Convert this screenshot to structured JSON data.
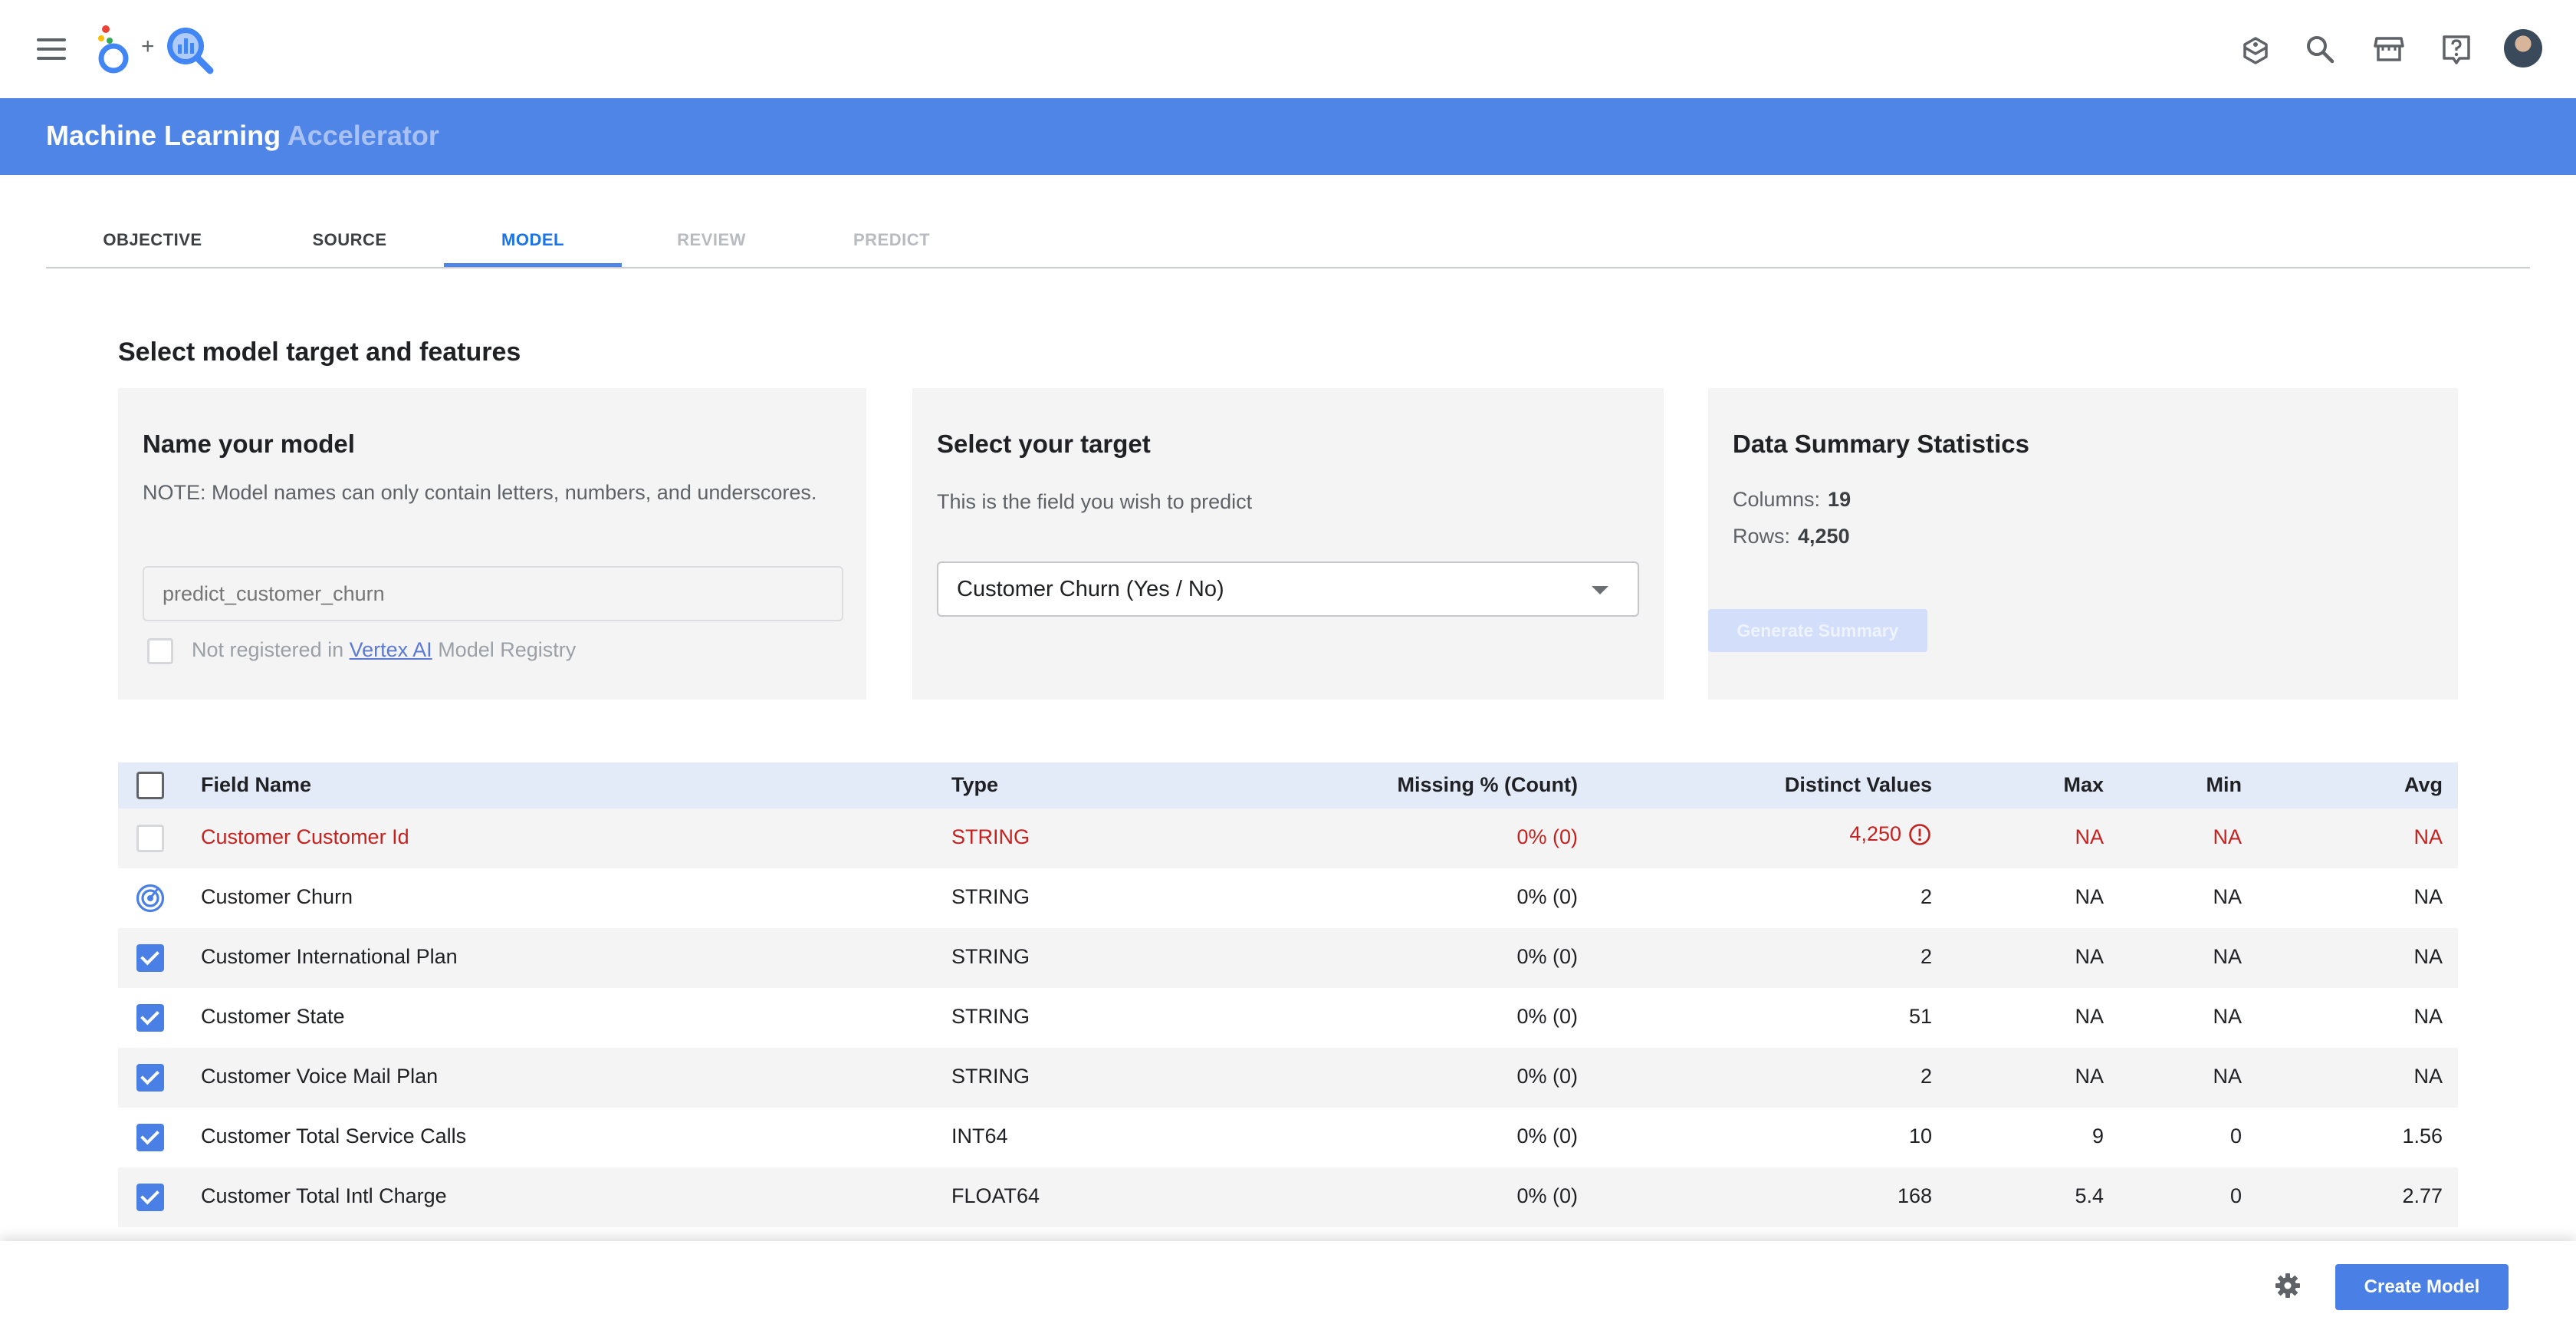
{
  "header": {
    "menu_icon": "hamburger-menu-icon",
    "logo_plus": "+",
    "icons": [
      "learn-icon",
      "search-icon",
      "marketplace-icon",
      "help-icon"
    ]
  },
  "banner": {
    "title_main": "Machine Learning",
    "title_accent": "Accelerator"
  },
  "tabs": [
    {
      "label": "OBJECTIVE",
      "state": "normal"
    },
    {
      "label": "SOURCE",
      "state": "normal"
    },
    {
      "label": "MODEL",
      "state": "active"
    },
    {
      "label": "REVIEW",
      "state": "disabled"
    },
    {
      "label": "PREDICT",
      "state": "disabled"
    }
  ],
  "section_title": "Select model target and features",
  "name_card": {
    "title": "Name your model",
    "note": "NOTE: Model names can only contain letters, numbers, and underscores.",
    "input_placeholder": "predict_customer_churn",
    "registry_prefix": "Not registered in ",
    "registry_link": "Vertex AI",
    "registry_suffix": " Model Registry"
  },
  "target_card": {
    "title": "Select your target",
    "subtitle": "This is the field you wish to predict",
    "selected": "Customer Churn (Yes / No)"
  },
  "stats_card": {
    "title": "Data Summary Statistics",
    "columns_label": "Columns:",
    "columns_value": "19",
    "rows_label": "Rows:",
    "rows_value": "4,250",
    "button": "Generate Summary"
  },
  "table": {
    "headers": {
      "field": "Field Name",
      "type": "Type",
      "missing": "Missing % (Count)",
      "distinct": "Distinct Values",
      "max": "Max",
      "min": "Min",
      "avg": "Avg"
    },
    "rows": [
      {
        "field": "Customer Customer Id",
        "type": "STRING",
        "missing": "0% (0)",
        "distinct": "4,250",
        "max": "NA",
        "min": "NA",
        "avg": "NA",
        "status": "error"
      },
      {
        "field": "Customer Churn",
        "type": "STRING",
        "missing": "0% (0)",
        "distinct": "2",
        "max": "NA",
        "min": "NA",
        "avg": "NA",
        "status": "target"
      },
      {
        "field": "Customer International Plan",
        "type": "STRING",
        "missing": "0% (0)",
        "distinct": "2",
        "max": "NA",
        "min": "NA",
        "avg": "NA",
        "status": "checked"
      },
      {
        "field": "Customer State",
        "type": "STRING",
        "missing": "0% (0)",
        "distinct": "51",
        "max": "NA",
        "min": "NA",
        "avg": "NA",
        "status": "checked"
      },
      {
        "field": "Customer Voice Mail Plan",
        "type": "STRING",
        "missing": "0% (0)",
        "distinct": "2",
        "max": "NA",
        "min": "NA",
        "avg": "NA",
        "status": "checked"
      },
      {
        "field": "Customer Total Service Calls",
        "type": "INT64",
        "missing": "0% (0)",
        "distinct": "10",
        "max": "9",
        "min": "0",
        "avg": "1.56",
        "status": "checked"
      },
      {
        "field": "Customer Total Intl Charge",
        "type": "FLOAT64",
        "missing": "0% (0)",
        "distinct": "168",
        "max": "5.4",
        "min": "0",
        "avg": "2.77",
        "status": "checked"
      }
    ]
  },
  "footer": {
    "settings_icon": "gear-icon",
    "create_button": "Create Model"
  },
  "colors": {
    "banner": "#5085e8",
    "accent": "#4a7fe6",
    "error": "#c5221f"
  }
}
